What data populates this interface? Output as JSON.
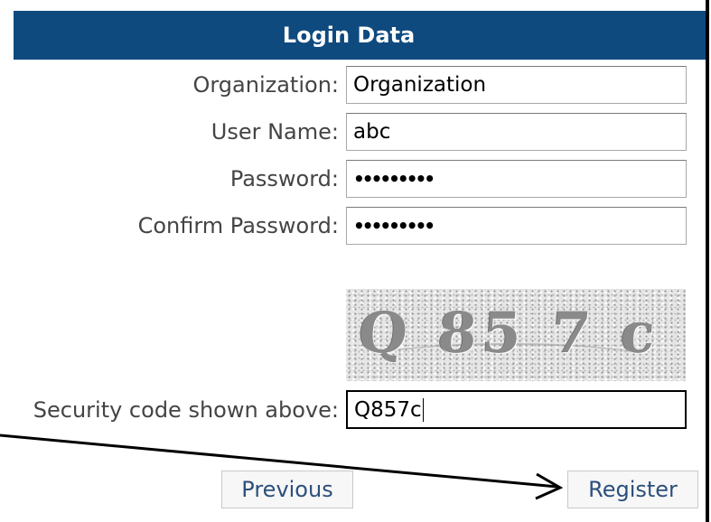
{
  "header": {
    "title": "Login Data"
  },
  "form": {
    "organization": {
      "label": "Organization:",
      "value": "Organization"
    },
    "username": {
      "label": "User Name:",
      "value": "abc"
    },
    "password": {
      "label": "Password:",
      "masked": "•••••••••"
    },
    "confirm_password": {
      "label": "Confirm Password:",
      "masked": "•••••••••"
    },
    "captcha": {
      "image_text": "Q 85 7 c"
    },
    "security_code": {
      "label": "Security code shown above:",
      "value": "Q857c"
    }
  },
  "buttons": {
    "previous": "Previous",
    "register": "Register"
  },
  "colors": {
    "header_bg": "#0f4a7e",
    "button_text": "#2d4f7c",
    "label_text": "#444444"
  }
}
